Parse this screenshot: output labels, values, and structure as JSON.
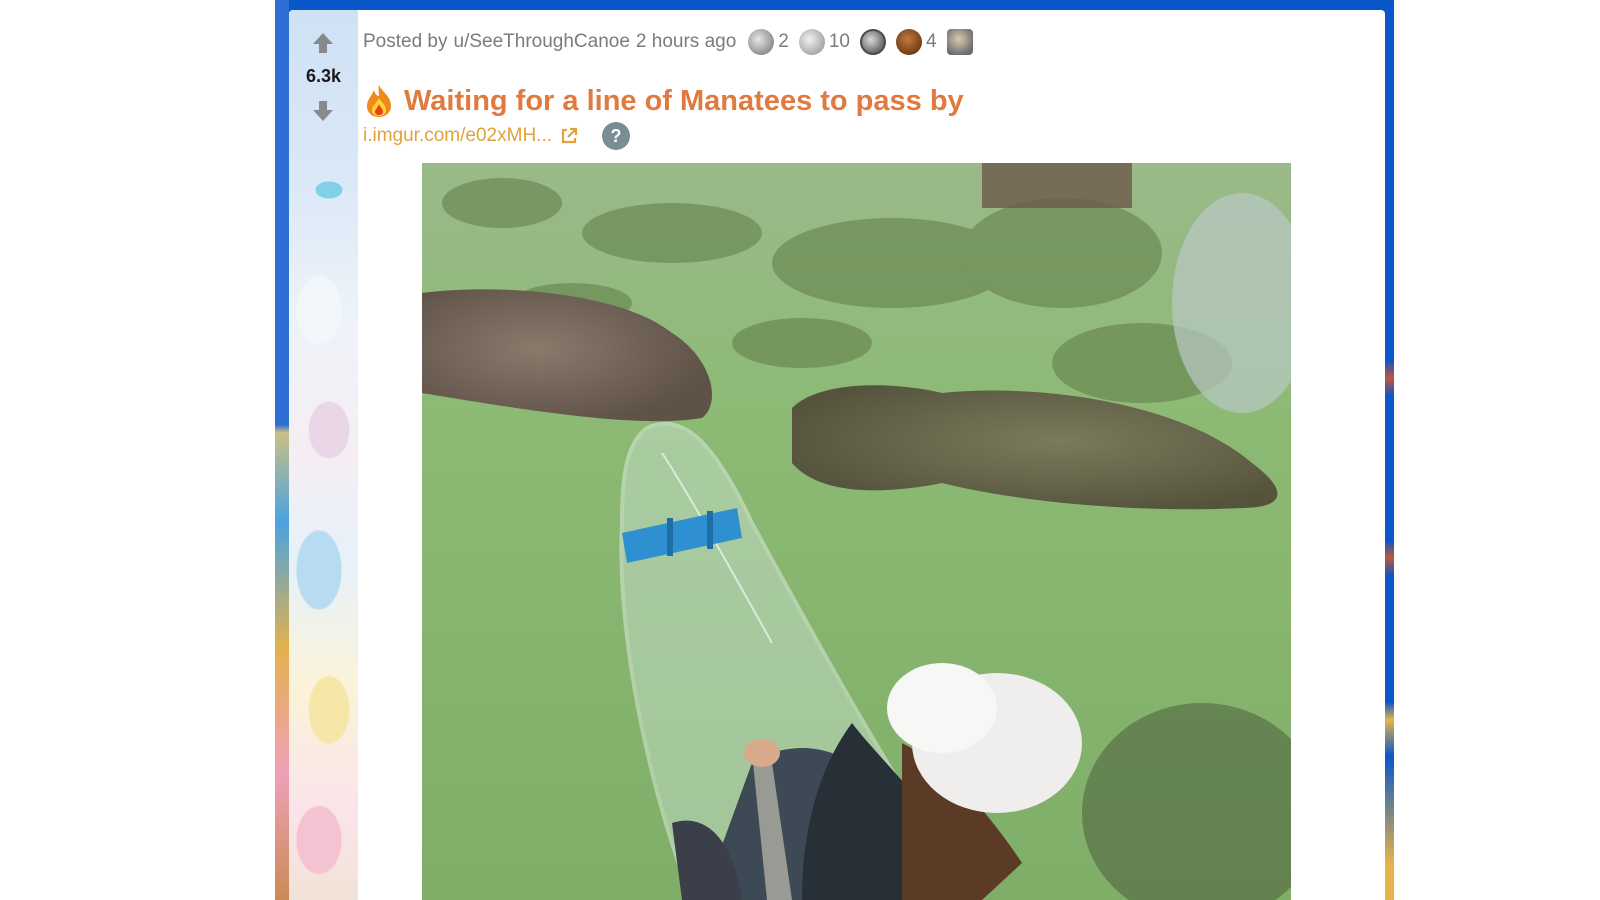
{
  "post": {
    "score": "6.3k",
    "meta": {
      "posted_by_label": "Posted by",
      "username": "u/SeeThroughCanoe",
      "time": "2 hours ago"
    },
    "awards": [
      {
        "icon": "silver-award-icon",
        "count": "2"
      },
      {
        "icon": "helpful-award-icon",
        "count": "10"
      },
      {
        "icon": "coin-award-icon",
        "count": ""
      },
      {
        "icon": "bear-award-icon",
        "count": "4"
      },
      {
        "icon": "group-award-icon",
        "count": ""
      }
    ],
    "title": "Waiting for a line of Manatees to pass by",
    "link_text": "i.imgur.com/e02xMH...",
    "help_label": "?"
  },
  "colors": {
    "title": "#e07a3e",
    "link": "#e0a33a",
    "meta": "#787c7e",
    "page_bg": "#0a57c9"
  }
}
